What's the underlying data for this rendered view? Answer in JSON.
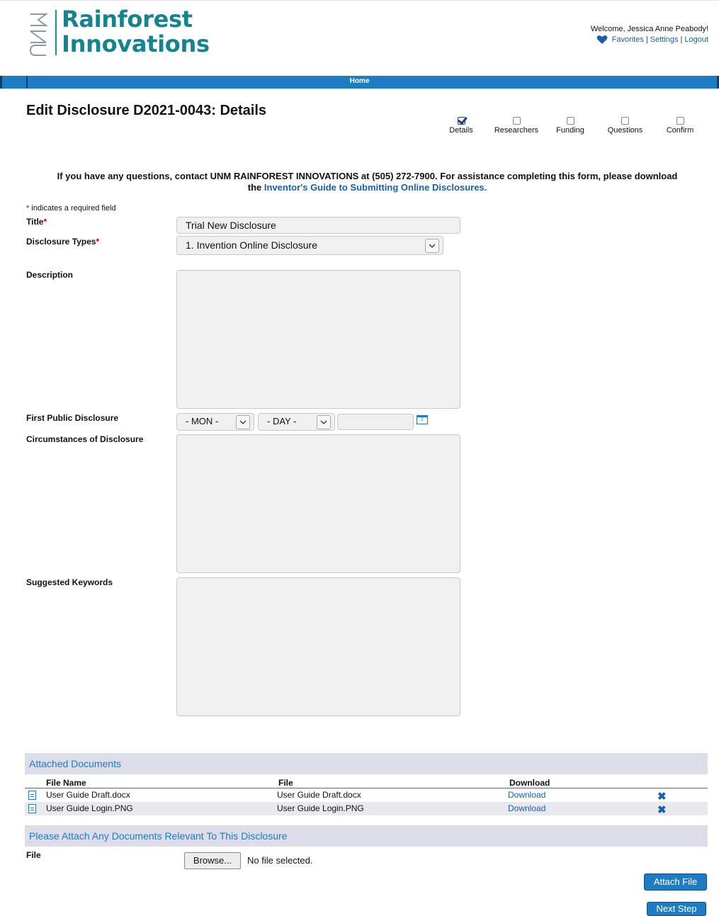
{
  "brand": {
    "mark": "UNM",
    "line1": "Rainforest",
    "line2": "Innovations"
  },
  "header": {
    "welcome": "Welcome, Jessica Anne Peabody!",
    "favorites": "Favorites",
    "settings": "Settings",
    "logout": "Logout",
    "sep": "|"
  },
  "nav": {
    "home": "Home"
  },
  "page": {
    "title": "Edit Disclosure D2021-0043: Details"
  },
  "steps": [
    {
      "label": "Details",
      "checked": true
    },
    {
      "label": "Researchers",
      "checked": false
    },
    {
      "label": "Funding",
      "checked": false
    },
    {
      "label": "Questions",
      "checked": false
    },
    {
      "label": "Confirm",
      "checked": false
    }
  ],
  "info": {
    "text1": "If you have any questions, contact UNM RAINFOREST INNOVATIONS at (505) 272-7900. For assistance completing this form, please download",
    "text2": "the",
    "link": "Inventor's Guide to Submitting Online Disclosures."
  },
  "form": {
    "required_star": "*",
    "required_note": " indicates a required field",
    "title_label": "Title",
    "title_value": "Trial New Disclosure",
    "types_label": "Disclosure Types",
    "types_value": "1. Invention Online Disclosure",
    "description_label": "Description",
    "first_public_label": "First Public Disclosure",
    "month_value": "- MON -",
    "day_value": "- DAY -",
    "year_value": "",
    "calendar_text": "2",
    "circumstances_label": "Circumstances of Disclosure",
    "keywords_label": "Suggested Keywords"
  },
  "attachments": {
    "header": "Attached Documents",
    "columns": [
      "File Name",
      "File",
      "Download"
    ],
    "rows": [
      {
        "name": "User Guide Draft.docx",
        "file": "User Guide Draft.docx",
        "download": "Download"
      },
      {
        "name": "User Guide Login.PNG",
        "file": "User Guide Login.PNG",
        "download": "Download"
      }
    ],
    "delete_glyph": "✖"
  },
  "upload": {
    "header": "Please Attach Any Documents Relevant To This Disclosure",
    "file_label": "File",
    "browse": "Browse...",
    "no_file": "No file selected.",
    "attach_button": "Attach File",
    "next_button": "Next Step"
  },
  "colors": {
    "brand_teal": "#16848f",
    "nav_blue": "#1e7cc4",
    "link_blue": "#1a5fa8",
    "required_red": "#c00000",
    "section_bg": "#dcdde8"
  }
}
